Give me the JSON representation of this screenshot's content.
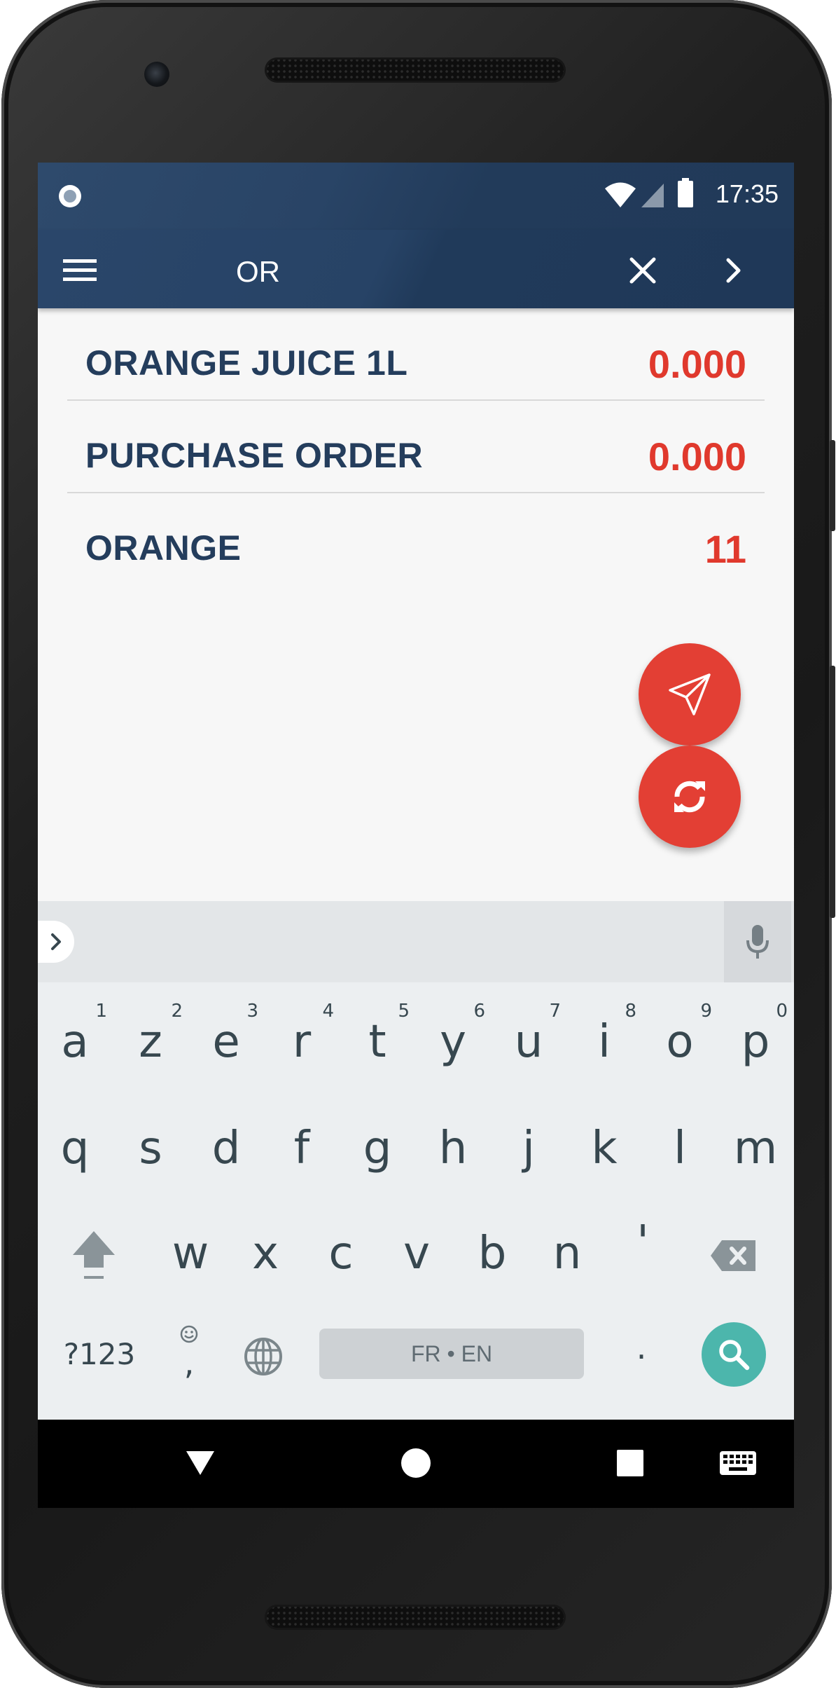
{
  "status_bar": {
    "time": "17:35"
  },
  "app_bar": {
    "search_query": "OR"
  },
  "results": [
    {
      "name": "ORANGE JUICE 1L",
      "value": "0.000"
    },
    {
      "name": "PURCHASE ORDER",
      "value": "0.000"
    },
    {
      "name": "ORANGE",
      "value": "11"
    }
  ],
  "keyboard": {
    "row1": [
      {
        "key": "a",
        "hint": "1"
      },
      {
        "key": "z",
        "hint": "2"
      },
      {
        "key": "e",
        "hint": "3"
      },
      {
        "key": "r",
        "hint": "4"
      },
      {
        "key": "t",
        "hint": "5"
      },
      {
        "key": "y",
        "hint": "6"
      },
      {
        "key": "u",
        "hint": "7"
      },
      {
        "key": "i",
        "hint": "8"
      },
      {
        "key": "o",
        "hint": "9"
      },
      {
        "key": "p",
        "hint": "0"
      }
    ],
    "row2": [
      "q",
      "s",
      "d",
      "f",
      "g",
      "h",
      "j",
      "k",
      "l",
      "m"
    ],
    "row3": [
      "w",
      "x",
      "c",
      "v",
      "b",
      "n",
      "'"
    ],
    "symbols_label": "?123",
    "comma_label": ",",
    "period_label": ".",
    "space_label": "FR • EN"
  },
  "colors": {
    "app_bar": "#223b5a",
    "accent": "#e33f34",
    "title_text": "#243d5c",
    "value_text": "#e0392d",
    "enter_key": "#4cb6ac"
  },
  "icons": [
    "menu-icon",
    "close-icon",
    "chevron-right-icon",
    "send-icon",
    "sync-icon",
    "mic-icon",
    "shift-icon",
    "backspace-icon",
    "globe-icon",
    "emoji-icon",
    "search-icon",
    "back-icon",
    "home-icon",
    "recents-icon",
    "keyboard-icon",
    "wifi-icon",
    "signal-icon",
    "battery-icon",
    "notification-icon"
  ]
}
